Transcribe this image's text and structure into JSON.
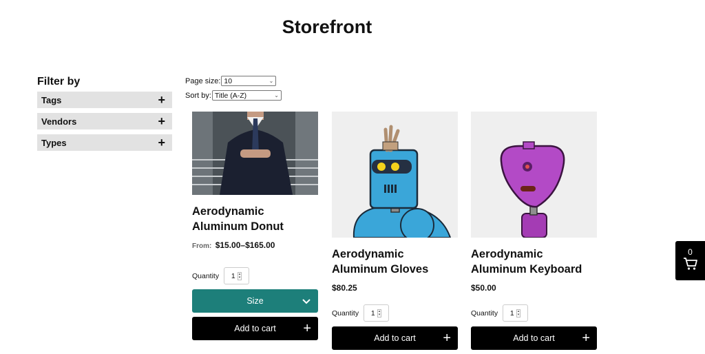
{
  "page": {
    "title": "Storefront"
  },
  "filters": {
    "heading": "Filter by",
    "items": [
      {
        "label": "Tags"
      },
      {
        "label": "Vendors"
      },
      {
        "label": "Types"
      }
    ]
  },
  "controls": {
    "page_size_label": "Page size:",
    "page_size_value": "10",
    "sort_label": "Sort by:",
    "sort_value": "Title (A-Z)"
  },
  "products": [
    {
      "name": "Aerodynamic Aluminum Donut",
      "price_prefix": "From:",
      "price": "$15.00–$165.00",
      "quantity_label": "Quantity",
      "quantity": "1",
      "variant_label": "Size",
      "add_label": "Add to cart",
      "image": "man-in-suit-photo"
    },
    {
      "name": "Aerodynamic Aluminum Gloves",
      "price": "$80.25",
      "quantity_label": "Quantity",
      "quantity": "1",
      "add_label": "Add to cart",
      "image": "blue-robot-illustration"
    },
    {
      "name": "Aerodynamic Aluminum Keyboard",
      "price": "$50.00",
      "quantity_label": "Quantity",
      "quantity": "1",
      "add_label": "Add to cart",
      "image": "purple-robot-illustration"
    }
  ],
  "cart": {
    "count": "0",
    "icon": "cart-icon"
  },
  "colors": {
    "accent": "#1d7f7a",
    "button": "#000000",
    "filter_bg": "#e2e2e2"
  }
}
